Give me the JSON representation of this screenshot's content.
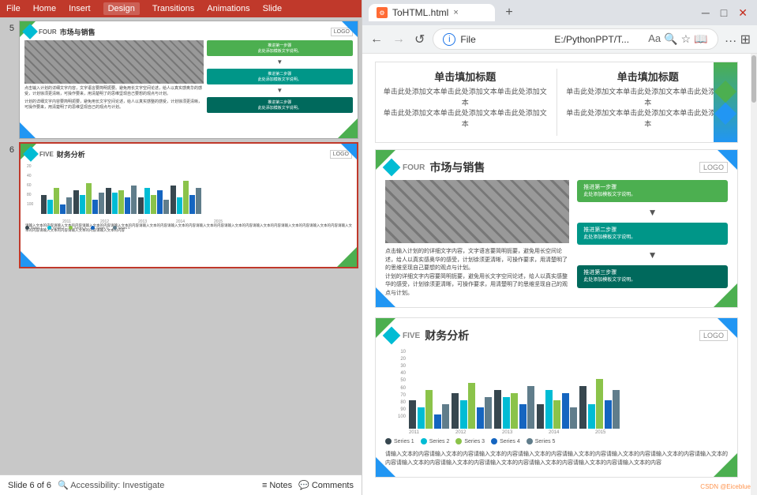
{
  "ppt": {
    "ribbon": {
      "items": [
        "File",
        "Home",
        "Insert",
        "Design",
        "Transitions",
        "Animations",
        "Slide"
      ]
    },
    "slides": {
      "slide5": {
        "number": "5",
        "label": "FOUR",
        "title": "市场与销售",
        "logo": "LOGO",
        "step1": "推进第一步骤",
        "step1_sub": "此处添加模板文字说明。",
        "step2": "推进第二步骤",
        "step2_sub": "此处添加模板文字说明。",
        "step3": "推进第三步骤",
        "step3_sub": "此处添加模板文字说明。",
        "body_text1": "点击输入计划的详细文字内容，文字语言要简明扼要。避免用长文字空间论述，给人以真实感奥华的感受，计划徐须更清晰，可操作要来，用清楚明了的思维坚现自己要想的观点与计划。",
        "body_text2": "计划的详细文字内容要简明扼要，避免用长文字空间论述，给人以真实感整的感受，计划徐须更清晰，可操作要来，用清楚明了的思维坚现自己的观点与计划。"
      },
      "slide6": {
        "number": "6",
        "label": "FIVE",
        "title": "财务分析",
        "logo": "LOGO",
        "body_text": "请输入文本的内容请输入文本的内容请输入文本的内容请输入文本的内容请输入文本的内容请输入文本的内容请输入文本的内容请输入文本的内容请输入文本的内容请输入文本的内容请输入文本的内容请输入文本的内容请输入文本的内容请输入文本的内容请输入文本的内容",
        "chart": {
          "y_labels": [
            "100",
            "80",
            "60",
            "40",
            "20"
          ],
          "x_labels": [
            "2011",
            "2012",
            "2013",
            "2014",
            "2015"
          ],
          "series": [
            {
              "name": "Series 1",
              "color": "#37474f"
            },
            {
              "name": "Series 2",
              "color": "#00bcd4"
            },
            {
              "name": "Series 3",
              "color": "#8bc34a"
            },
            {
              "name": "Series 4",
              "color": "#1565c0"
            },
            {
              "name": "Series 5",
              "color": "#607d8b"
            }
          ],
          "groups": [
            {
              "bars": [
                40,
                30,
                55,
                20,
                35
              ]
            },
            {
              "bars": [
                50,
                40,
                65,
                30,
                45
              ]
            },
            {
              "bars": [
                55,
                45,
                50,
                35,
                60
              ]
            },
            {
              "bars": [
                35,
                55,
                40,
                50,
                30
              ]
            },
            {
              "bars": [
                60,
                35,
                70,
                40,
                55
              ]
            }
          ]
        }
      }
    },
    "statusbar": {
      "slide_info": "Slide 6 of 6",
      "accessibility": "Accessibility: Investigate",
      "notes": "Notes",
      "comments": "Comments"
    }
  },
  "browser": {
    "titlebar": {
      "tab_title": "ToHTML.html",
      "tab_close": "×",
      "new_tab": "+"
    },
    "addressbar": {
      "url": "E:/PythonPPT/T...",
      "info_btn": "i"
    },
    "content": {
      "slide_top_partial": {
        "center_title": "单击填加标题",
        "center_sub_lines": [
          "单击此处添加文本单击此处添加文本单击此处添加文本",
          "单击此处添加文本单击此处添加文本单击此处添加文本"
        ]
      },
      "slide4": {
        "label": "FOUR",
        "title": "市场与销售",
        "logo": "LOGO",
        "step1": "推进第一步骤",
        "step1_sub": "此处添加模板文字说明。",
        "step2": "推进第二步骤",
        "step2_sub": "此处添加模板文字说明。",
        "step3": "推进第三步骤",
        "step3_sub": "此处添加模板文字说明。",
        "body_text1": "点击输入计划的的详细文字内容，文字语言要简明扼要，避免用长空间论述，给人以真实感奥华的感受，计划徐须更清晰，可操作要求，用清楚明了的思维坚现自己要想的观点与计划。",
        "body_text2": "计划的详细文字内容要简明扼要，避免用长文字空间论述，给人以真实感整华的感受，计划徐须更清晰，可操作要求，用清楚明了的思维坚现自己的观点与计划。"
      },
      "slide5_browser": {
        "label": "FIVE",
        "title": "财务分析",
        "logo": "LOGO",
        "chart": {
          "y_labels": [
            "100",
            "90",
            "80",
            "70",
            "60",
            "50",
            "40",
            "30",
            "20",
            "10"
          ],
          "x_labels": [
            "2011",
            "2012",
            "2013",
            "2014",
            "2015"
          ],
          "series": [
            {
              "name": "Series 1",
              "color": "#37474f"
            },
            {
              "name": "Series 2",
              "color": "#00bcd4"
            },
            {
              "name": "Series 3",
              "color": "#8bc34a"
            },
            {
              "name": "Series 4",
              "color": "#1565c0"
            },
            {
              "name": "Series 5",
              "color": "#607d8b"
            }
          ],
          "groups": [
            {
              "bars": [
                40,
                30,
                55,
                20,
                35
              ]
            },
            {
              "bars": [
                50,
                40,
                65,
                30,
                45
              ]
            },
            {
              "bars": [
                55,
                45,
                50,
                35,
                60
              ]
            },
            {
              "bars": [
                35,
                55,
                40,
                50,
                30
              ]
            },
            {
              "bars": [
                60,
                35,
                70,
                40,
                55
              ]
            }
          ]
        },
        "bottom_text": "请输入文本的内容请输入文本的内容请输入文本的内容请输入文本的内容请输入文本的内容请输入文本的内容请输入文本的内容请输入文本的内容请输入文本的内容请输入文本的内容请输入文本的内容请输入文本的内容请输入文本的内容请输入文本的内容"
      }
    },
    "watermark": "CSDN @Eiceblue"
  }
}
